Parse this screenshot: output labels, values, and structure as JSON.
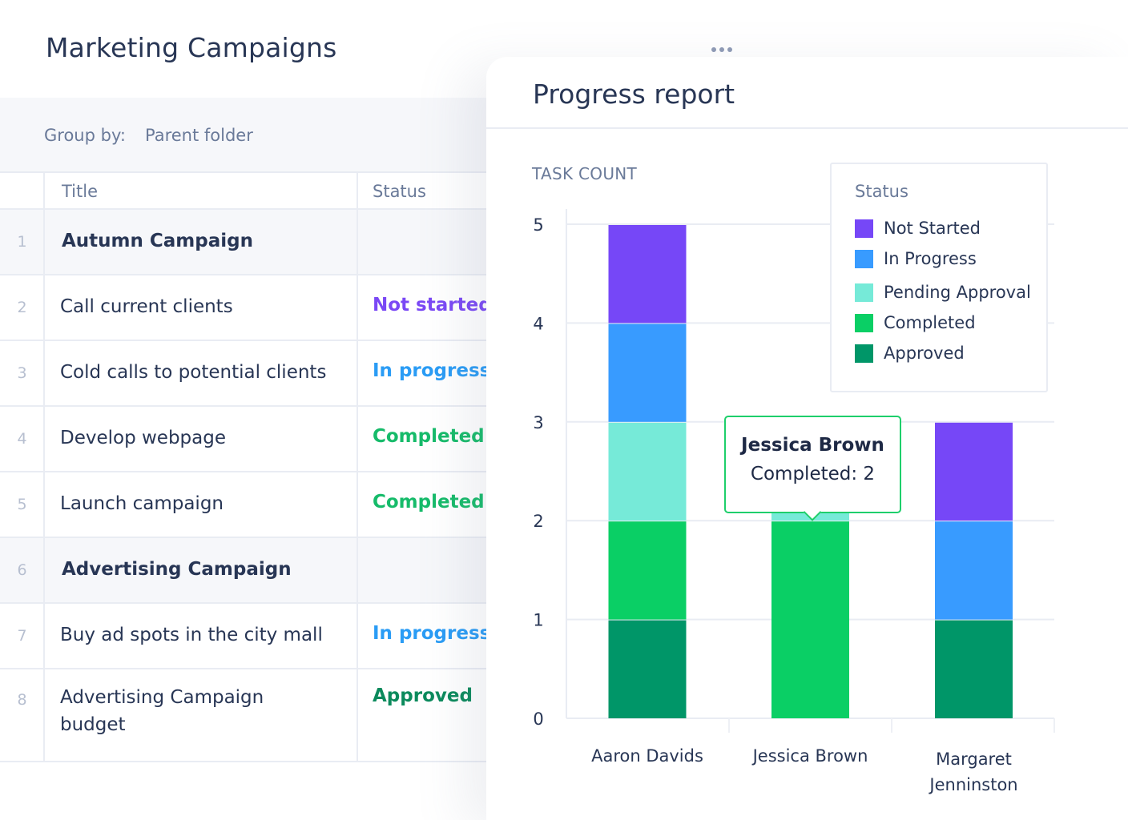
{
  "page": {
    "title": "Marketing Campaigns",
    "more_icon": "ellipsis-horizontal-icon",
    "group_by_label": "Group by:",
    "group_by_value": "Parent folder"
  },
  "table": {
    "columns": [
      "Title",
      "Status"
    ],
    "rows": [
      {
        "num": "1",
        "title": "Autumn Campaign",
        "status": "",
        "group": true
      },
      {
        "num": "2",
        "title": "Call current clients",
        "status": "Not started",
        "status_color": "#7a48f5"
      },
      {
        "num": "3",
        "title": "Cold calls to potential clients",
        "status": "In progress",
        "status_color": "#2a9cf5"
      },
      {
        "num": "4",
        "title": "Develop webpage",
        "status": "Completed",
        "status_color": "#16bb6a"
      },
      {
        "num": "5",
        "title": "Launch campaign",
        "status": "Completed",
        "status_color": "#16bb6a"
      },
      {
        "num": "6",
        "title": "Advertising Campaign",
        "status": "",
        "group": true
      },
      {
        "num": "7",
        "title": "Buy ad spots in the city mall",
        "status": "In progress",
        "status_color": "#2a9cf5"
      },
      {
        "num": "8",
        "title": "Advertising Campaign budget",
        "title_lines": [
          "Advertising Campaign",
          "budget"
        ],
        "status": "Approved",
        "status_color": "#0b8a5c"
      }
    ]
  },
  "panel": {
    "title": "Progress report"
  },
  "chart_data": {
    "type": "bar",
    "stacked": true,
    "title": "Progress report",
    "ylabel": "TASK COUNT",
    "xlabel": "",
    "categories": [
      "Aaron Davids",
      "Jessica Brown",
      "Margaret Jenninston"
    ],
    "category_lines": [
      [
        "Aaron Davids"
      ],
      [
        "Jessica Brown"
      ],
      [
        "Margaret",
        "Jenninston"
      ]
    ],
    "ylim": [
      0,
      5
    ],
    "yticks": [
      0,
      1,
      2,
      3,
      4,
      5
    ],
    "grid": true,
    "legend_title": "Status",
    "legend_position": "top-right",
    "series": [
      {
        "name": "Approved",
        "color": "#009668",
        "values": [
          1,
          0,
          1
        ]
      },
      {
        "name": "Completed",
        "color": "#0acf65",
        "values": [
          1,
          2,
          0
        ]
      },
      {
        "name": "Pending Approval",
        "color": "#76ead8",
        "values": [
          1,
          1,
          0
        ]
      },
      {
        "name": "In Progress",
        "color": "#389bff",
        "values": [
          1,
          0,
          1
        ]
      },
      {
        "name": "Not Started",
        "color": "#7647f7",
        "values": [
          1,
          0,
          1
        ]
      }
    ],
    "legend_order": [
      "Not Started",
      "In Progress",
      "Pending Approval",
      "Completed",
      "Approved"
    ],
    "tooltip": {
      "category": "Jessica Brown",
      "label": "Completed: 2",
      "border_color": "#1ecf6b"
    }
  }
}
